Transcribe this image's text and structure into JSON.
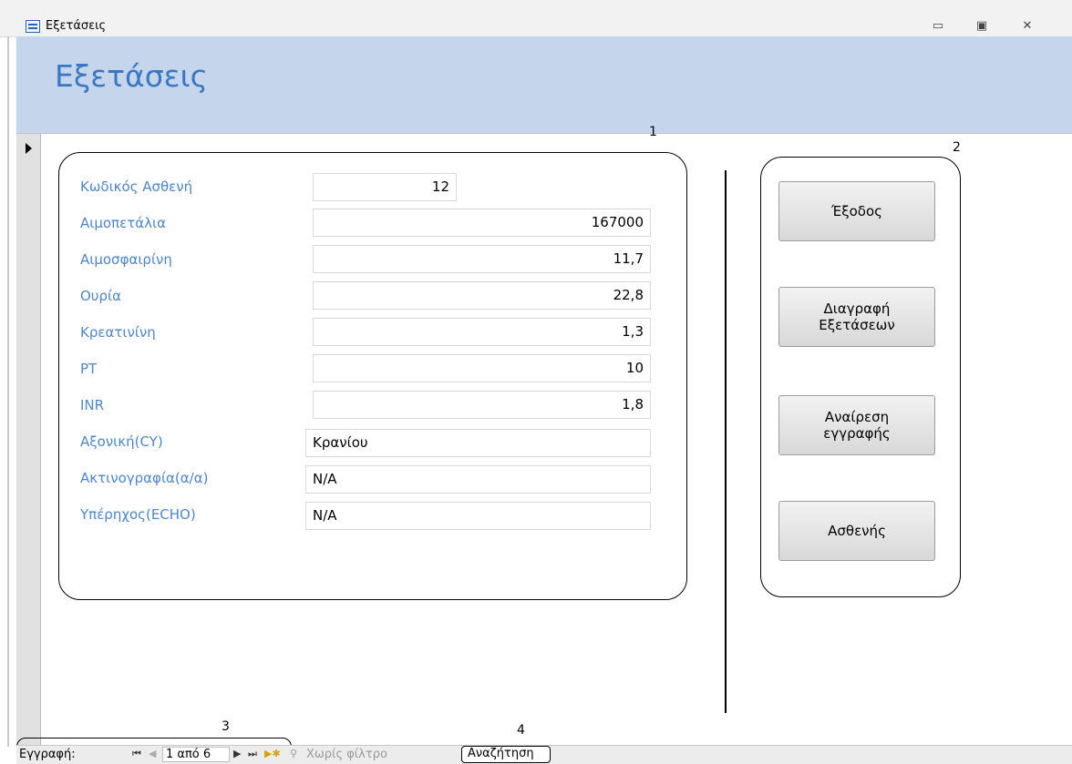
{
  "window": {
    "title": "Εξετάσεις",
    "minimize_icon": "minimize-icon",
    "maximize_icon": "maximize-icon",
    "close_icon": "close-icon"
  },
  "header": {
    "form_title": "Εξετάσεις"
  },
  "callouts": {
    "c1": "1",
    "c2": "2",
    "c3": "3",
    "c4": "4"
  },
  "fields": {
    "patient_code": {
      "label": "Κωδικός Ασθενή",
      "value": "12"
    },
    "platelets": {
      "label": "Αιμοπετάλια",
      "value": "167000"
    },
    "hemoglobin": {
      "label": "Αιμοσφαιρίνη",
      "value": "11,7"
    },
    "urea": {
      "label": "Ουρία",
      "value": "22,8"
    },
    "creatinine": {
      "label": "Κρεατινίνη",
      "value": "1,3"
    },
    "pt": {
      "label": "PT",
      "value": "10"
    },
    "inr": {
      "label": "INR",
      "value": "1,8"
    },
    "ct": {
      "label": "Αξονική(CY)",
      "value": "Κρανίου"
    },
    "xray": {
      "label": "Ακτινογραφία(α/α)",
      "value": "N/A"
    },
    "echo": {
      "label": "Υπέρηχος(ECHO)",
      "value": "N/A"
    }
  },
  "buttons": {
    "exit": "Έξοδος",
    "delete_exams_line1": "Διαγραφή",
    "delete_exams_line2": "Εξετάσεων",
    "undo_line1": "Αναίρεση",
    "undo_line2": "εγγραφής",
    "patient": "Ασθενής"
  },
  "statusbar": {
    "record_label": "Εγγραφή:",
    "record_counter": "1 από 6",
    "filter": "Χωρίς φίλτρο",
    "search": "Αναζήτηση"
  },
  "colors": {
    "header_band": "#c5d6ec",
    "title_blue": "#3a78c2",
    "label_blue": "#4f86c6"
  }
}
